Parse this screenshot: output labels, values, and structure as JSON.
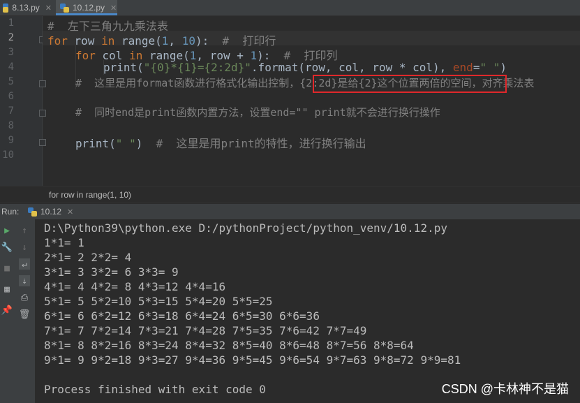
{
  "tabs": [
    {
      "label": "8.13.py",
      "active": false
    },
    {
      "label": "10.12.py",
      "active": true
    }
  ],
  "editor": {
    "line_numbers": [
      "1",
      "2",
      "3",
      "4",
      "5",
      "6",
      "7",
      "8",
      "9",
      "10"
    ],
    "current_line": "2",
    "lines": {
      "l1_comment": "#  左下三角九九乘法表",
      "l2_for": "for",
      "l2_row": " row ",
      "l2_in": "in",
      "l2_range": " range(",
      "l2_n1": "1",
      "l2_comma": ", ",
      "l2_n2": "10",
      "l2_close": "):  ",
      "l2_comment": "#  打印行",
      "l3_for": "for",
      "l3_col": " col ",
      "l3_in": "in",
      "l3_range": " range(",
      "l3_n1": "1",
      "l3_mid": ", row + ",
      "l3_n2": "1",
      "l3_close": "):  ",
      "l3_comment": "#  打印列",
      "l4_print": "print(",
      "l4_str1": "\"{0}*{1}={2:2d}\"",
      "l4_fmt": ".format(row, col, row * col), ",
      "l4_end": "end",
      "l4_eq": "=",
      "l4_str2": "\" \"",
      "l4_close": ")",
      "l5_comment": "#  这里是用format函数进行格式化输出控制，{2:2d}是给{2}这个位置两倍的空间，对齐乘法表",
      "l7_comment": "#  同时end是print函数内置方法，设置end=\"\" print就不会进行换行操作",
      "l9_print": "print(",
      "l9_str": "\" \"",
      "l9_close": ")  ",
      "l9_comment": "#  这里是用print的特性，进行换行输出"
    }
  },
  "breadcrumb": "for row in range(1, 10)",
  "run": {
    "label": "Run:",
    "tab_label": "10.12",
    "console_lines": [
      "D:\\Python39\\python.exe D:/pythonProject/python_venv/10.12.py",
      "1*1= 1",
      "2*1= 2 2*2= 4",
      "3*1= 3 3*2= 6 3*3= 9",
      "4*1= 4 4*2= 8 4*3=12 4*4=16",
      "5*1= 5 5*2=10 5*3=15 5*4=20 5*5=25",
      "6*1= 6 6*2=12 6*3=18 6*4=24 6*5=30 6*6=36",
      "7*1= 7 7*2=14 7*3=21 7*4=28 7*5=35 7*6=42 7*7=49",
      "8*1= 8 8*2=16 8*3=24 8*4=32 8*5=40 8*6=48 8*7=56 8*8=64",
      "9*1= 9 9*2=18 9*3=27 9*4=36 9*5=45 9*6=54 9*7=63 9*8=72 9*9=81",
      "",
      "Process finished with exit code 0"
    ]
  },
  "watermark": "CSDN @卡林神不是猫",
  "colors": {
    "highlight_box": "#e0282b",
    "keyword": "#cc7832",
    "number": "#6897bb",
    "string": "#6a8759",
    "comment": "#808080"
  }
}
